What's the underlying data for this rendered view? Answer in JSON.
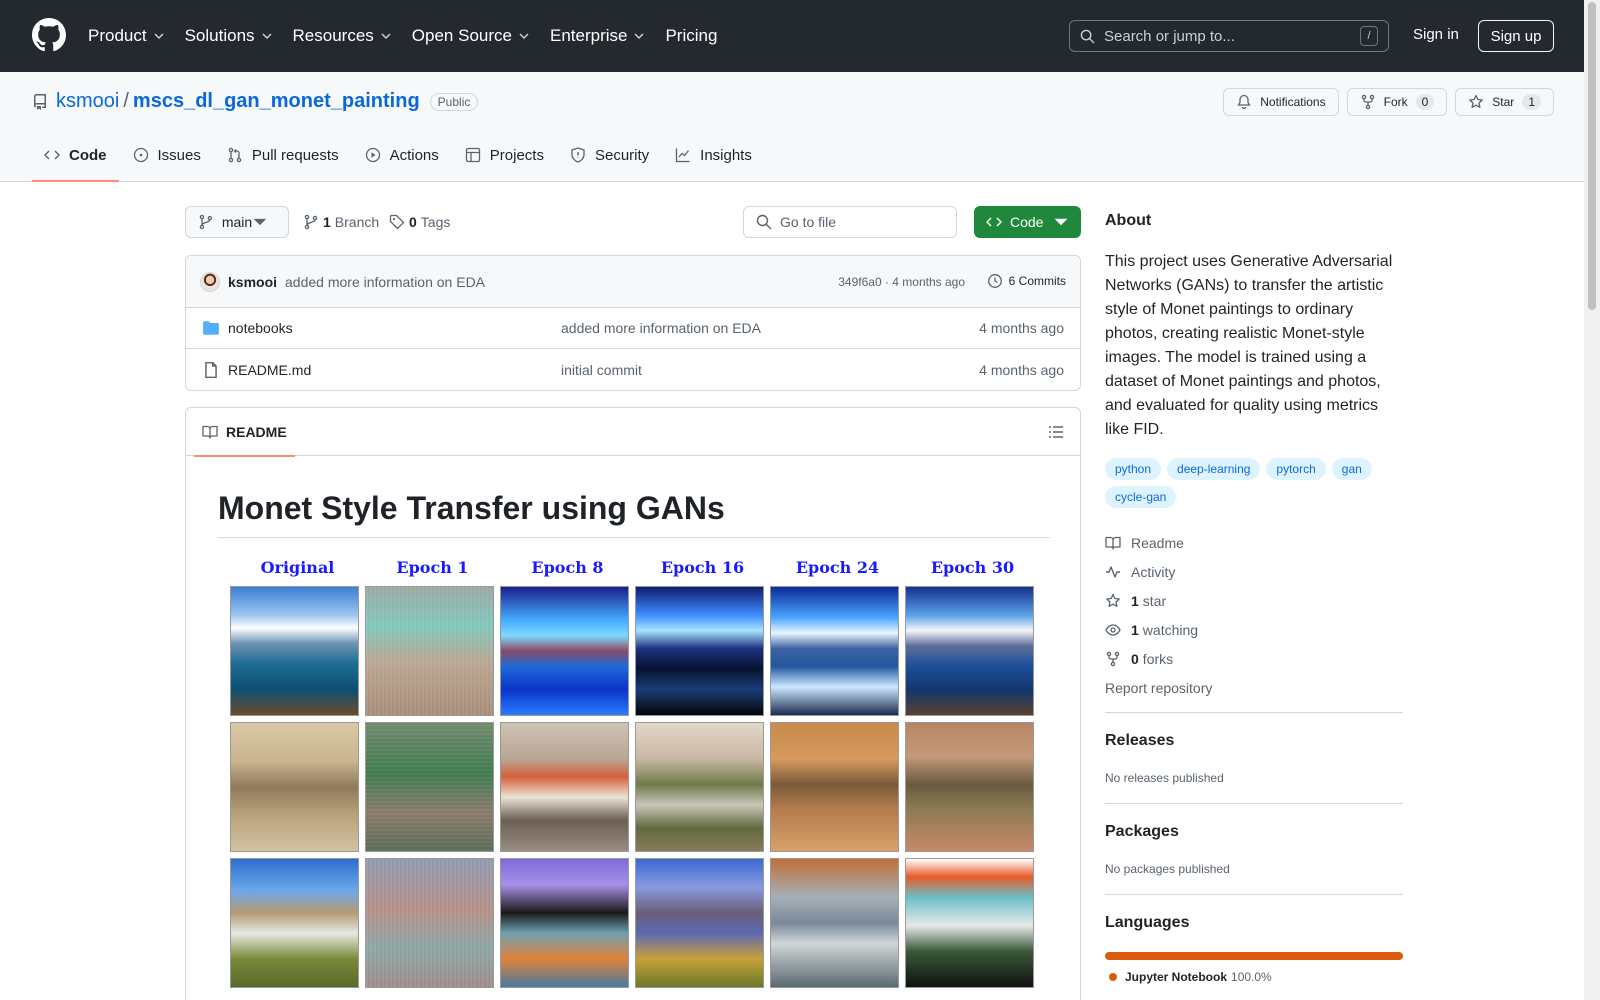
{
  "global_nav": {
    "items": [
      {
        "label": "Product",
        "has_menu": true
      },
      {
        "label": "Solutions",
        "has_menu": true
      },
      {
        "label": "Resources",
        "has_menu": true
      },
      {
        "label": "Open Source",
        "has_menu": true
      },
      {
        "label": "Enterprise",
        "has_menu": true
      },
      {
        "label": "Pricing",
        "has_menu": false
      }
    ],
    "search_placeholder": "Search or jump to...",
    "search_shortcut": "/",
    "sign_in": "Sign in",
    "sign_up": "Sign up"
  },
  "repo": {
    "owner": "ksmooi",
    "separator": "/",
    "name": "mscs_dl_gan_monet_painting",
    "visibility": "Public",
    "notifications_label": "Notifications",
    "fork_label": "Fork",
    "fork_count": "0",
    "star_label": "Star",
    "star_count": "1"
  },
  "tabs": [
    {
      "label": "Code",
      "icon": "code-icon",
      "active": true
    },
    {
      "label": "Issues",
      "icon": "issue-icon",
      "active": false
    },
    {
      "label": "Pull requests",
      "icon": "pull-request-icon",
      "active": false
    },
    {
      "label": "Actions",
      "icon": "play-icon",
      "active": false
    },
    {
      "label": "Projects",
      "icon": "table-icon",
      "active": false
    },
    {
      "label": "Security",
      "icon": "shield-icon",
      "active": false
    },
    {
      "label": "Insights",
      "icon": "graph-icon",
      "active": false
    }
  ],
  "branch_bar": {
    "branch": "main",
    "branch_count": "1",
    "branch_label": "Branch",
    "tag_count": "0",
    "tag_label": "Tags",
    "goto_file_placeholder": "Go to file",
    "code_button": "Code"
  },
  "latest_commit": {
    "author": "ksmooi",
    "message": "added more information on EDA",
    "meta": "349f6a0 · 4 months ago",
    "commits_label": "6 Commits"
  },
  "files": [
    {
      "type": "folder",
      "name": "notebooks",
      "commit": "added more information on EDA",
      "age": "4 months ago"
    },
    {
      "type": "file",
      "name": "README.md",
      "commit": "initial commit",
      "age": "4 months ago"
    }
  ],
  "readme": {
    "tab_label": "README",
    "title": "Monet Style Transfer using GANs",
    "epoch_labels": [
      "Original",
      "Epoch 1",
      "Epoch 8",
      "Epoch 16",
      "Epoch 24",
      "Epoch 30"
    ]
  },
  "about": {
    "title": "About",
    "description": "This project uses Generative Adversarial Networks (GANs) to transfer the artistic style of Monet paintings to ordinary photos, creating realistic Monet-style images. The model is trained using a dataset of Monet paintings and photos, and evaluated for quality using metrics like FID.",
    "topics": [
      "python",
      "deep-learning",
      "pytorch",
      "gan",
      "cycle-gan"
    ],
    "links": {
      "readme": "Readme",
      "activity": "Activity",
      "stars_count": "1",
      "stars_label": "star",
      "watching_count": "1",
      "watching_label": "watching",
      "forks_count": "0",
      "forks_label": "forks",
      "report": "Report repository"
    }
  },
  "releases": {
    "title": "Releases",
    "empty": "No releases published"
  },
  "packages": {
    "title": "Packages",
    "empty": "No packages published"
  },
  "languages": {
    "title": "Languages",
    "items": [
      {
        "name": "Jupyter Notebook",
        "percent": "100.0%",
        "color": "#da5b0b"
      }
    ]
  },
  "colors": {
    "header_bg": "#24292f",
    "link": "#0969da",
    "primary_button": "#1f883d",
    "tab_underline": "#fd8c73"
  }
}
